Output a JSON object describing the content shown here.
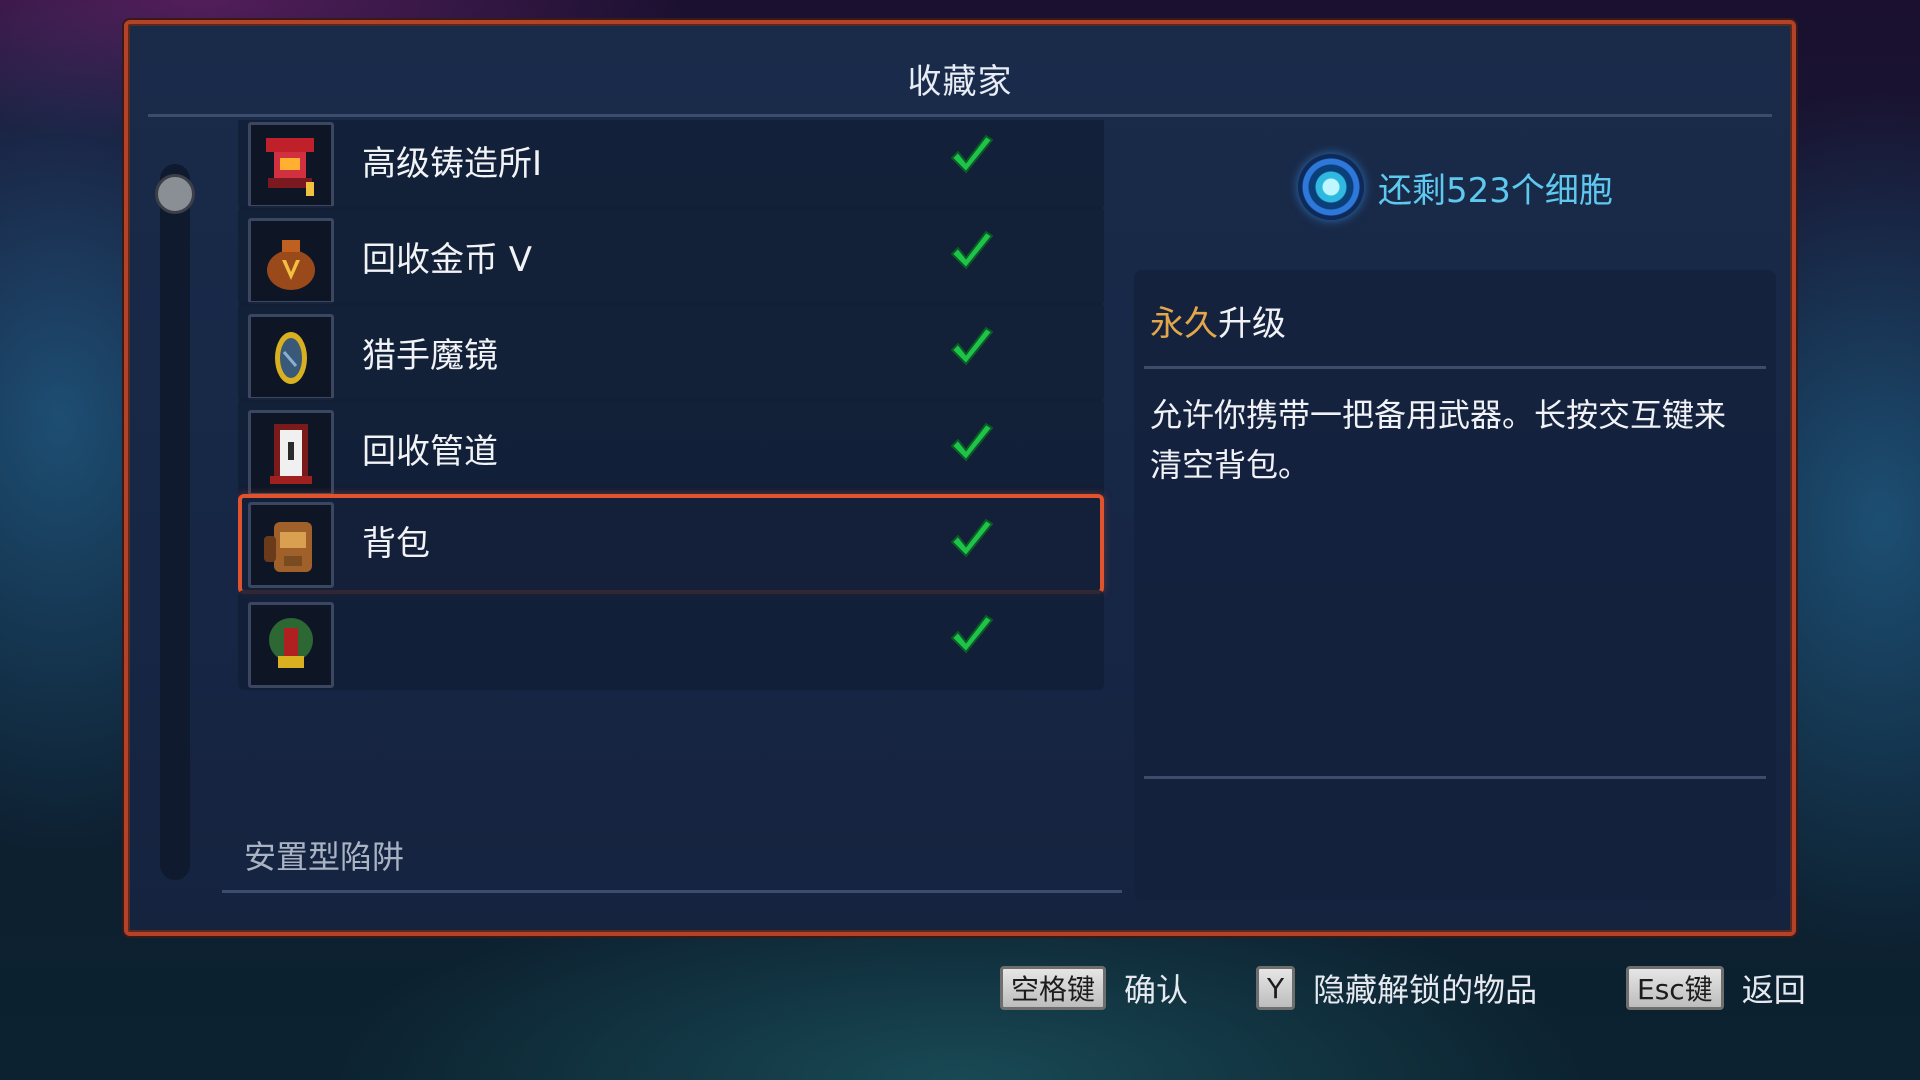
{
  "window": {
    "title": "收藏家"
  },
  "list": {
    "items": [
      {
        "label": "高级铸造所I",
        "icon": "forge-icon",
        "unlocked": true
      },
      {
        "label": "回收金币 V",
        "icon": "gold-bag-icon",
        "unlocked": true
      },
      {
        "label": "猎手魔镜",
        "icon": "mirror-icon",
        "unlocked": true
      },
      {
        "label": "回收管道",
        "icon": "recycle-pipe-icon",
        "unlocked": true
      },
      {
        "label": "背包",
        "icon": "backpack-icon",
        "unlocked": true,
        "selected": true
      },
      {
        "label": "",
        "icon": "totem-icon",
        "unlocked": true
      }
    ],
    "section_label": "安置型陷阱"
  },
  "details": {
    "cells_text": "还剩523个细胞",
    "cells_icon": "cell-icon",
    "heading_accent": "永久",
    "heading_rest": "升级",
    "description": "允许你携带一把备用武器。长按交互键来清空背包。"
  },
  "hints": [
    {
      "key": "空格键",
      "label": "确认"
    },
    {
      "key": "Y",
      "label": "隐藏解锁的物品"
    },
    {
      "key": "Esc键",
      "label": "返回"
    }
  ],
  "colors": {
    "panel_border": "#b4422a",
    "selected_border": "#e0532c",
    "accent_orange": "#e3a64a",
    "cells_blue": "#5ec8ee",
    "check_green": "#1fc24a"
  }
}
